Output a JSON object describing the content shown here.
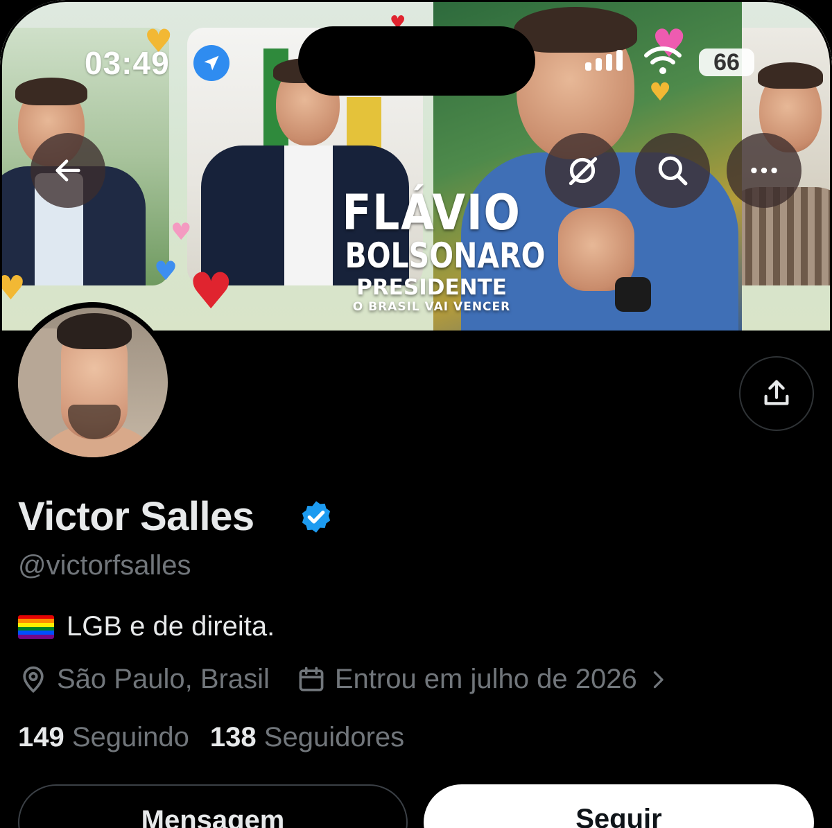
{
  "status_bar": {
    "time": "03:49",
    "battery": "66",
    "location_icon": "location-arrow-icon",
    "signal_icon": "cellular-signal-icon",
    "wifi_icon": "wifi-icon"
  },
  "banner": {
    "line1": "FLÁVIO",
    "line2": "BOLSONARO",
    "line3": "PRESIDENTE",
    "line4": "O BRASIL VAI VENCER"
  },
  "top_actions": {
    "back_icon": "arrow-left-icon",
    "grok_icon": "grok-icon",
    "search_icon": "search-icon",
    "more_icon": "more-horizontal-icon"
  },
  "profile": {
    "display_name": "Victor Salles",
    "handle": "@victorfsalles",
    "bio": "LGB e de direita.",
    "location": "São Paulo, Brasil",
    "joined": "Entrou em julho de 2026",
    "following_count": "149",
    "following_label": "Seguindo",
    "followers_count": "138",
    "followers_label": "Seguidores"
  },
  "actions": {
    "message_label": "Mensagem",
    "follow_label": "Seguir"
  },
  "colors": {
    "background": "#000000",
    "primary_text": "#e7e9ea",
    "secondary_text": "#71767b",
    "verified_blue": "#1d9bf0",
    "location_badge": "#2f8cf0"
  }
}
